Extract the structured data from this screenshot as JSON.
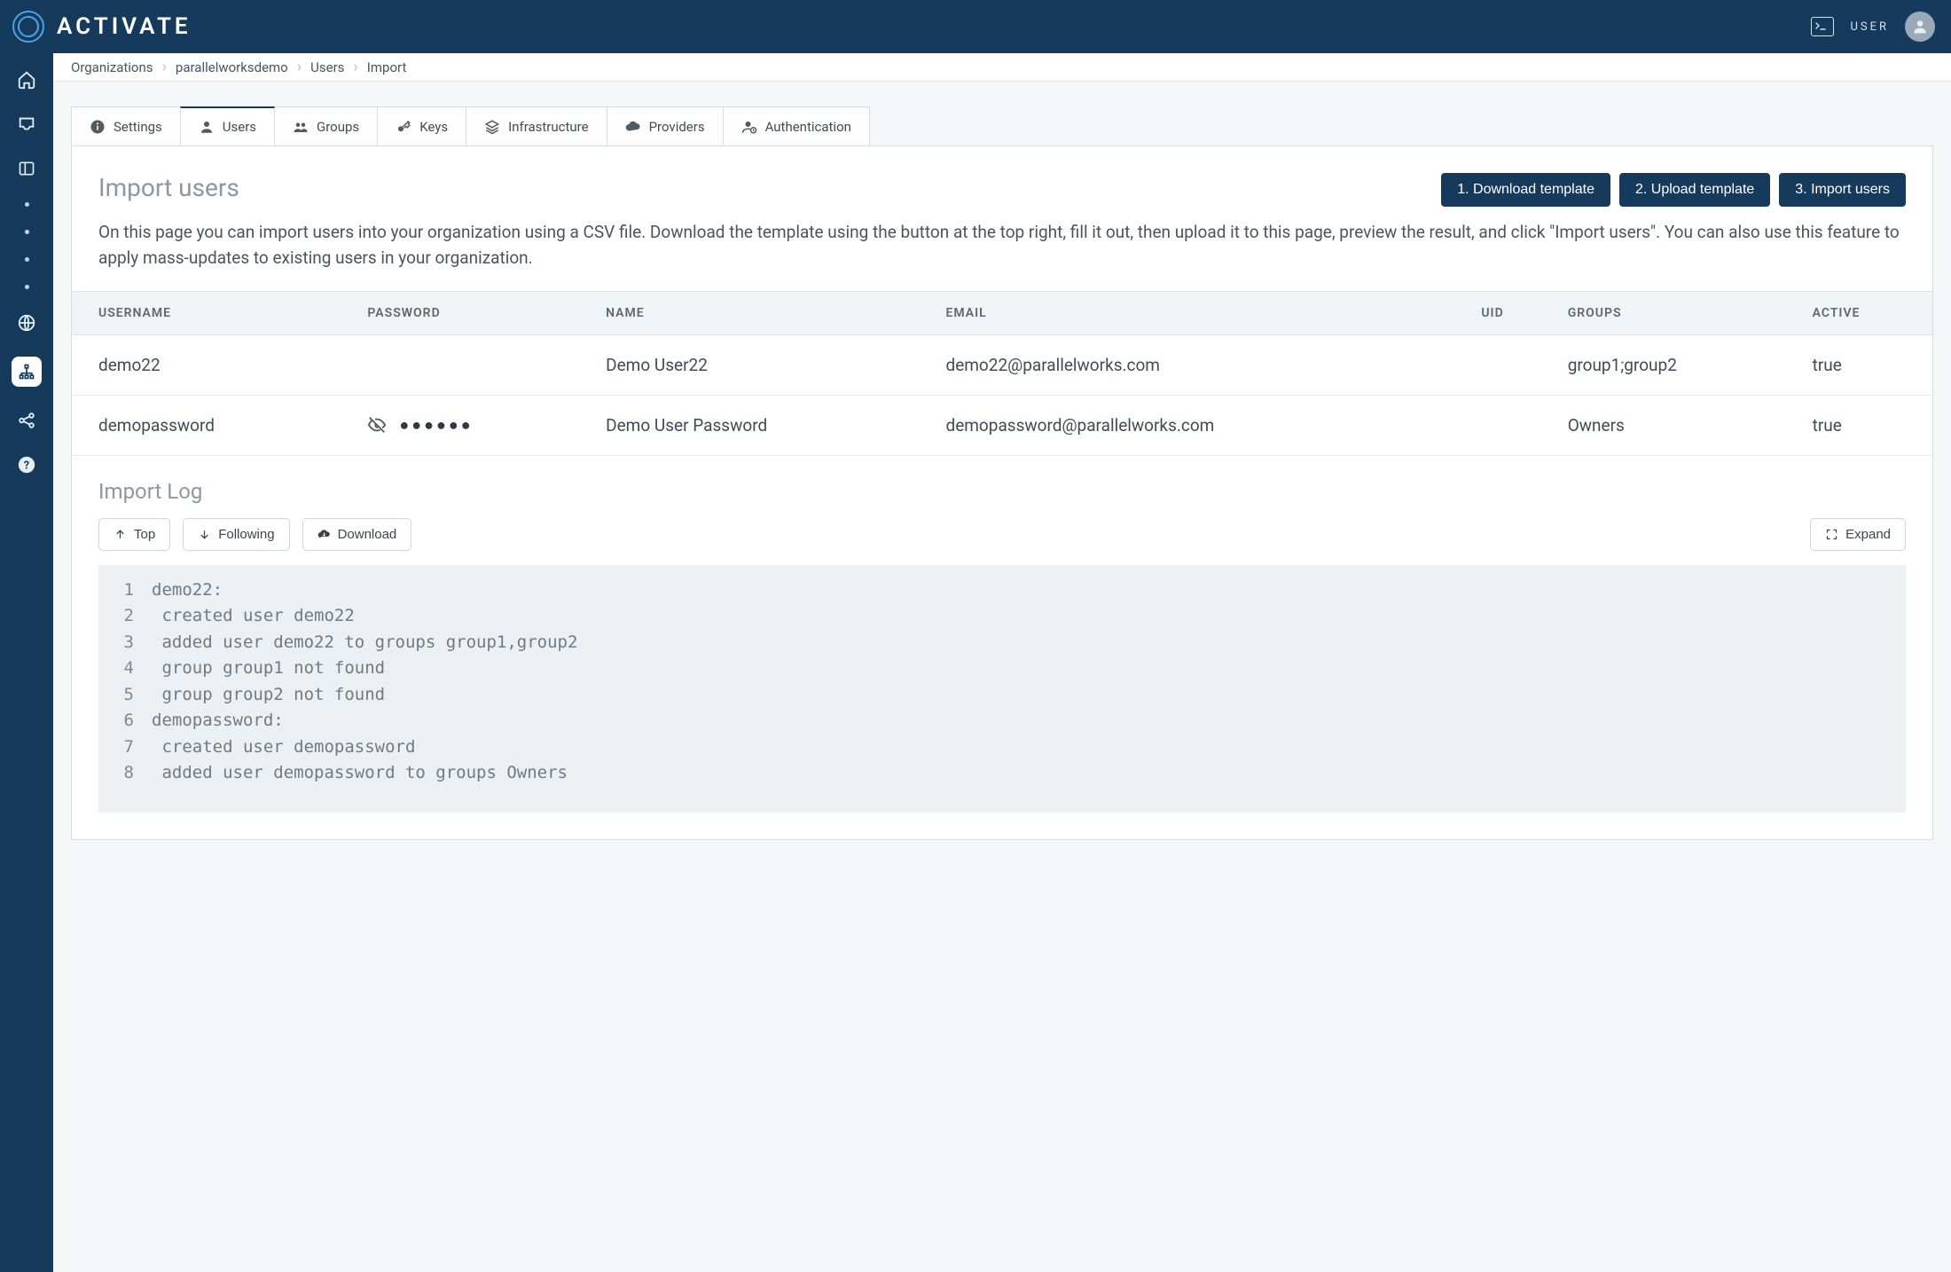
{
  "brand": {
    "name": "ACTIVATE"
  },
  "topbar": {
    "user_label": "USER"
  },
  "breadcrumbs": [
    "Organizations",
    "parallelworksdemo",
    "Users",
    "Import"
  ],
  "tabs": [
    {
      "id": "settings",
      "label": "Settings"
    },
    {
      "id": "users",
      "label": "Users"
    },
    {
      "id": "groups",
      "label": "Groups"
    },
    {
      "id": "keys",
      "label": "Keys"
    },
    {
      "id": "infrastructure",
      "label": "Infrastructure"
    },
    {
      "id": "providers",
      "label": "Providers"
    },
    {
      "id": "authentication",
      "label": "Authentication"
    }
  ],
  "active_tab": "users",
  "page": {
    "title": "Import users",
    "description": "On this page you can import users into your organization using a CSV file. Download the template using the button at the top right, fill it out, then upload it to this page, preview the result, and click \"Import users\". You can also use this feature to apply mass-updates to existing users in your organization."
  },
  "actions": {
    "download_template": "1. Download template",
    "upload_template": "2. Upload template",
    "import_users": "3. Import users"
  },
  "table": {
    "columns": {
      "username": "USERNAME",
      "password": "PASSWORD",
      "name": "NAME",
      "email": "EMAIL",
      "uid": "UID",
      "groups": "GROUPS",
      "active": "ACTIVE"
    },
    "rows": [
      {
        "username": "demo22",
        "password_masked": "",
        "has_password": false,
        "name": "Demo User22",
        "email": "demo22@parallelworks.com",
        "uid": "",
        "groups": "group1;group2",
        "active": "true"
      },
      {
        "username": "demopassword",
        "password_masked": "●●●●●●",
        "has_password": true,
        "name": "Demo User Password",
        "email": "demopassword@parallelworks.com",
        "uid": "",
        "groups": "Owners",
        "active": "true"
      }
    ]
  },
  "log": {
    "title": "Import Log",
    "toolbar": {
      "top": "Top",
      "following": "Following",
      "download": "Download",
      "expand": "Expand"
    },
    "lines": [
      "demo22:",
      " created user demo22",
      " added user demo22 to groups group1,group2",
      " group group1 not found",
      " group group2 not found",
      "demopassword:",
      " created user demopassword",
      " added user demopassword to groups Owners"
    ]
  }
}
